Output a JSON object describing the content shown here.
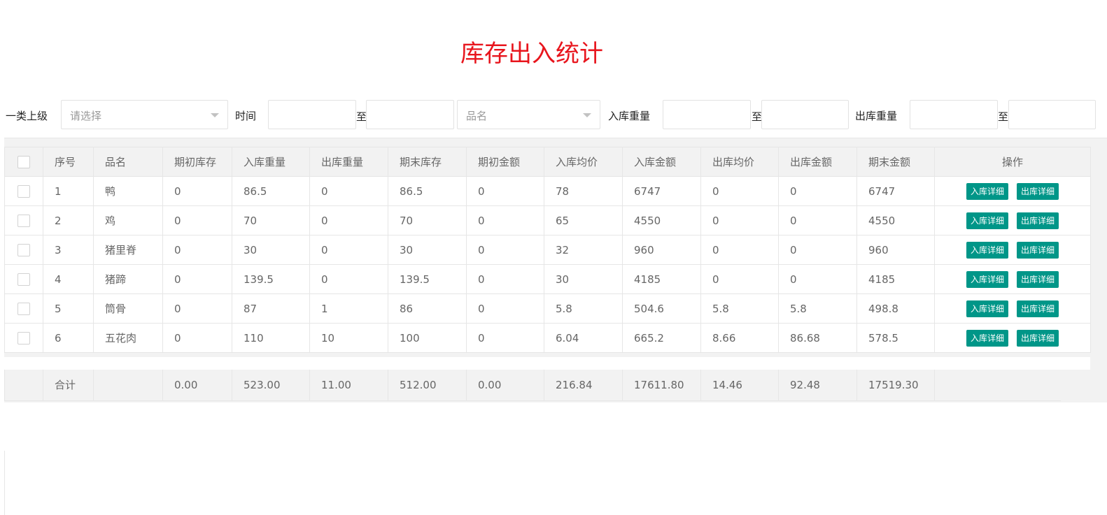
{
  "title": "库存出入统计",
  "filters": {
    "category_label": "一类上级",
    "category_placeholder": "请选择",
    "time_label": "时间",
    "to_label": "至",
    "name_placeholder": "品名",
    "in_weight_label": "入库重量",
    "out_weight_label": "出库重量"
  },
  "columns": [
    "序号",
    "品名",
    "期初库存",
    "入库重量",
    "出库重量",
    "期末库存",
    "期初金额",
    "入库均价",
    "入库金额",
    "出库均价",
    "出库金额",
    "期末金额",
    "操作"
  ],
  "rows": [
    {
      "no": "1",
      "name": "鸭",
      "open_stock": "0",
      "in_weight": "86.5",
      "out_weight": "0",
      "close_stock": "86.5",
      "open_amount": "0",
      "in_avg": "78",
      "in_amount": "6747",
      "out_avg": "0",
      "out_amount": "0",
      "close_amount": "6747"
    },
    {
      "no": "2",
      "name": "鸡",
      "open_stock": "0",
      "in_weight": "70",
      "out_weight": "0",
      "close_stock": "70",
      "open_amount": "0",
      "in_avg": "65",
      "in_amount": "4550",
      "out_avg": "0",
      "out_amount": "0",
      "close_amount": "4550"
    },
    {
      "no": "3",
      "name": "猪里脊",
      "open_stock": "0",
      "in_weight": "30",
      "out_weight": "0",
      "close_stock": "30",
      "open_amount": "0",
      "in_avg": "32",
      "in_amount": "960",
      "out_avg": "0",
      "out_amount": "0",
      "close_amount": "960"
    },
    {
      "no": "4",
      "name": "猪蹄",
      "open_stock": "0",
      "in_weight": "139.5",
      "out_weight": "0",
      "close_stock": "139.5",
      "open_amount": "0",
      "in_avg": "30",
      "in_amount": "4185",
      "out_avg": "0",
      "out_amount": "0",
      "close_amount": "4185"
    },
    {
      "no": "5",
      "name": "筒骨",
      "open_stock": "0",
      "in_weight": "87",
      "out_weight": "1",
      "close_stock": "86",
      "open_amount": "0",
      "in_avg": "5.8",
      "in_amount": "504.6",
      "out_avg": "5.8",
      "out_amount": "5.8",
      "close_amount": "498.8"
    },
    {
      "no": "6",
      "name": "五花肉",
      "open_stock": "0",
      "in_weight": "110",
      "out_weight": "10",
      "close_stock": "100",
      "open_amount": "0",
      "in_avg": "6.04",
      "in_amount": "665.2",
      "out_avg": "8.66",
      "out_amount": "86.68",
      "close_amount": "578.5"
    }
  ],
  "row_actions": {
    "in_detail": "入库详细",
    "out_detail": "出库详细"
  },
  "totals": {
    "label": "合计",
    "open_stock": "0.00",
    "in_weight": "523.00",
    "out_weight": "11.00",
    "close_stock": "512.00",
    "open_amount": "0.00",
    "in_avg": "216.84",
    "in_amount": "17611.80",
    "out_avg": "14.46",
    "out_amount": "92.48",
    "close_amount": "17519.30"
  },
  "colors": {
    "title": "#e8151d",
    "button": "#009688"
  }
}
